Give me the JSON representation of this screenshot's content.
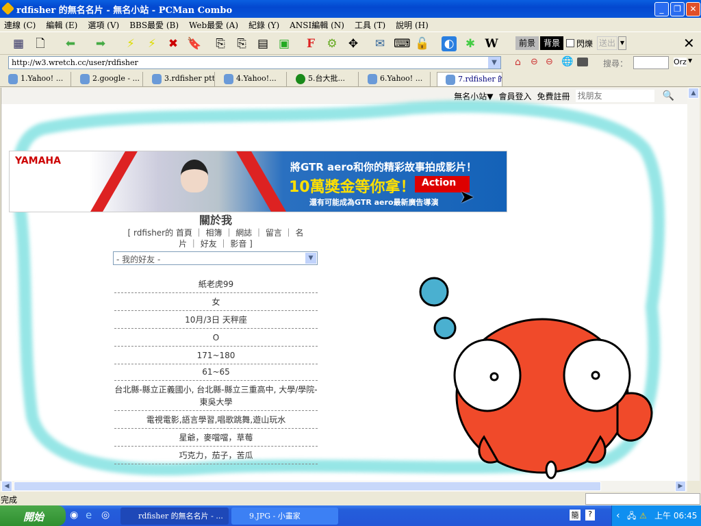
{
  "window": {
    "title": "rdfisher 的無名名片 - 無名小站 - PCMan Combo"
  },
  "menu": [
    "連線 (C)",
    "編輯 (E)",
    "選項 (V)",
    "BBS最愛 (B)",
    "Web最愛 (A)",
    "紀錄 (Y)",
    "ANSI編輯 (N)",
    "工具 (T)",
    "說明 (H)"
  ],
  "ansi": {
    "fg": "前景",
    "bg": "背景",
    "blink": "閃爍",
    "send": "送出"
  },
  "address": {
    "url": "http://w3.wretch.cc/user/rdfisher"
  },
  "search": {
    "label": "搜尋：",
    "engine": "Orz"
  },
  "tabs": [
    "1.Yahoo! ...",
    "2.google - ...",
    "3.rdfisher ptt",
    "4.Yahoo!...",
    "5.台大批...",
    "6.Yahoo! ...",
    "7.rdfisher 的"
  ],
  "site_nav": {
    "site": "無名小站▼",
    "login": "會員登入",
    "register": "免費註冊",
    "find_placeholder": "找朋友"
  },
  "banner": {
    "brand": "YAMAHA",
    "line1": "將GTR aero和你的精彩故事拍成影片！",
    "line2": "10萬獎金等你拿！",
    "action": "Action",
    "line3": "還有可能成為GTR aero最新廣告導演"
  },
  "about": {
    "title": "關於我",
    "nav_line1": "[ rdfisher的 首頁 ｜ 相簿 ｜ 網誌 ｜ 留言 ｜ 名",
    "nav_line2": "片 ｜ 好友 ｜ 影音 ]",
    "friends_select": "- 我的好友 -"
  },
  "profile": [
    "紙老虎99",
    "女",
    "10月/3日 天秤座",
    "O",
    "171~180",
    "61~65",
    "台北縣-縣立正義國小, 台北縣-縣立三重高中, 大學/學院-東吳大學",
    "電視電影,語言學習,唱歌跳舞,遊山玩水",
    "星爺，麥噹噹，草莓",
    "巧克力，茄子，苦瓜"
  ],
  "status": "完成",
  "taskbar": {
    "start": "開始",
    "tasks": [
      "rdfisher 的無名名片 - ...",
      "9.JPG - 小畫家"
    ],
    "clock": "上午 06:45"
  }
}
